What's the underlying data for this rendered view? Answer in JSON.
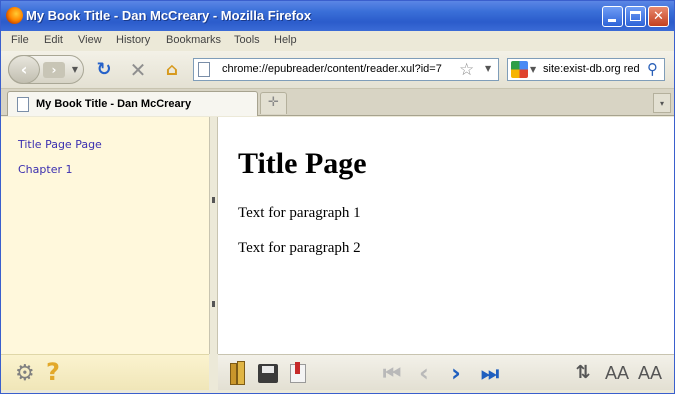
{
  "window": {
    "title": "My Book Title - Dan McCreary - Mozilla Firefox",
    "minimize_symbol": "",
    "maximize_symbol": "",
    "close_symbol": "✕"
  },
  "menubar": {
    "items": [
      {
        "label": "File"
      },
      {
        "label": "Edit"
      },
      {
        "label": "View"
      },
      {
        "label": "History"
      },
      {
        "label": "Bookmarks"
      },
      {
        "label": "Tools"
      },
      {
        "label": "Help"
      }
    ]
  },
  "navbar": {
    "back_symbol": "‹",
    "forward_symbol": "›",
    "reload_symbol": "↻",
    "stop_symbol": "✕",
    "home_symbol": "⌂",
    "url": "chrome://epubreader/content/reader.xul?id=7",
    "bookmark_star_symbol": "☆",
    "search_value": "site:exist-db.org red",
    "search_icon_symbol": "⚲"
  },
  "tabs": {
    "active_label": "My Book Title - Dan McCreary",
    "new_tab_symbol": "✛",
    "list_symbol": "▾"
  },
  "sidebar": {
    "toc": [
      {
        "label": "Title Page Page"
      },
      {
        "label": "Chapter 1"
      }
    ],
    "settings_symbol": "⚙",
    "help_symbol": "?"
  },
  "content": {
    "heading": "Title Page",
    "paragraphs": [
      {
        "text": "Text for paragraph 1"
      },
      {
        "text": "Text for paragraph 2"
      }
    ]
  },
  "reader_toolbar": {
    "first_symbol": "⏮",
    "prev_symbol": "‹",
    "next_symbol": "›",
    "last_symbol": "⏭",
    "line_spacing_symbol": "⇅",
    "font_decrease_label": "AA",
    "font_increase_label": "AA"
  },
  "colors": {
    "titlebar": "#2b5ccb",
    "sidebar_bg": "#fff8dc",
    "toc_link": "#3b2fb0",
    "nav_active": "#1f5fbf",
    "nav_disabled": "#b9b9b9"
  }
}
